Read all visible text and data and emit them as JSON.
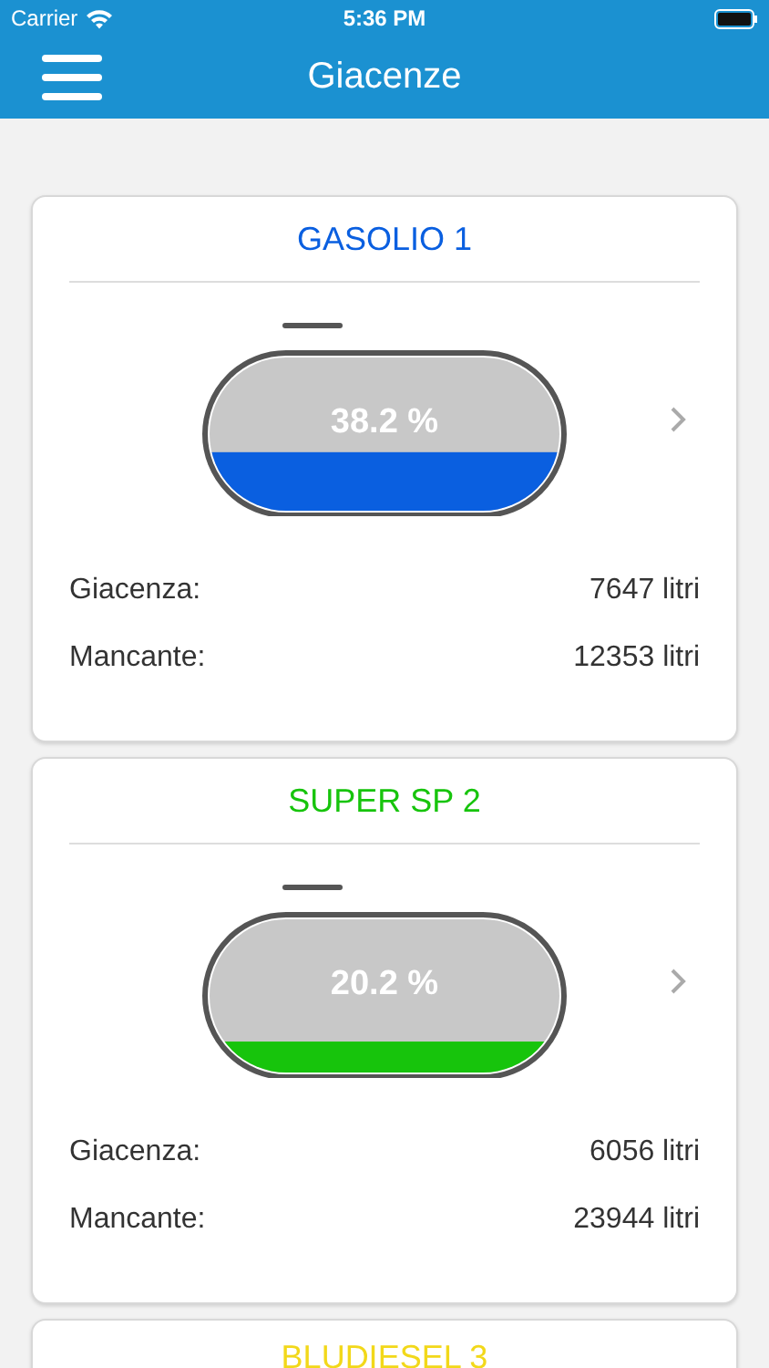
{
  "status_bar": {
    "carrier": "Carrier",
    "time": "5:36 PM"
  },
  "nav_bar": {
    "title": "Giacenze"
  },
  "tanks": [
    {
      "name": "GASOLIO 1",
      "color": "#0a5fe0",
      "reading": "38.2 %",
      "rows": [
        {
          "label": "Giacenza:",
          "value": "7647 litri"
        },
        {
          "label": "Mancante:",
          "value": "12353 litri"
        }
      ]
    },
    {
      "name": "SUPER SP 2",
      "color": "#17c40c",
      "reading": "20.2 %",
      "rows": [
        {
          "label": "Giacenza:",
          "value": "6056 litri"
        },
        {
          "label": "Mancante:",
          "value": "23944 litri"
        }
      ]
    },
    {
      "name": "BLUDIESEL 3",
      "color": "#f2d81a"
    }
  ]
}
